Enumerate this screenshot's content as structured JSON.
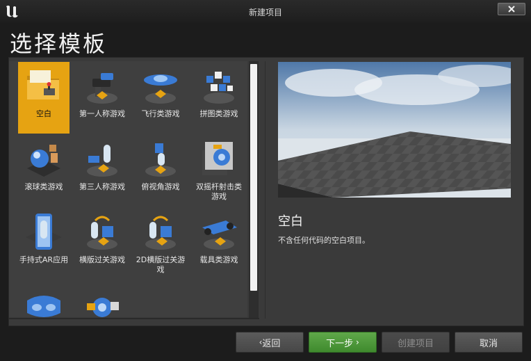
{
  "window": {
    "title": "新建项目"
  },
  "heading": "选择模板",
  "templates": [
    {
      "label": "空白",
      "icon": "folder-icon",
      "selected": true
    },
    {
      "label": "第一人称游戏",
      "icon": "first-person-icon"
    },
    {
      "label": "飞行类游戏",
      "icon": "flying-icon"
    },
    {
      "label": "拼图类游戏",
      "icon": "puzzle-icon"
    },
    {
      "label": "滚球类游戏",
      "icon": "rolling-ball-icon"
    },
    {
      "label": "第三人称游戏",
      "icon": "third-person-icon"
    },
    {
      "label": "俯视角游戏",
      "icon": "top-down-icon"
    },
    {
      "label": "双摇杆射击类游戏",
      "icon": "twin-stick-icon"
    },
    {
      "label": "手持式AR应用",
      "icon": "handheld-ar-icon"
    },
    {
      "label": "横版过关游戏",
      "icon": "side-scroller-icon"
    },
    {
      "label": "2D横版过关游戏",
      "icon": "2d-side-scroller-icon"
    },
    {
      "label": "载具类游戏",
      "icon": "vehicle-icon"
    },
    {
      "label": "",
      "icon": "vr-headset-icon"
    },
    {
      "label": "",
      "icon": "vehicle-advanced-icon"
    }
  ],
  "preview": {
    "title": "空白",
    "description": "不含任何代码的空白项目。"
  },
  "buttons": {
    "back": "返回",
    "next": "下一步",
    "create": "创建项目",
    "cancel": "取消"
  },
  "colors": {
    "selection": "#e6a312",
    "next_button": "#4f9a3c",
    "panel": "#3a3a3a"
  }
}
